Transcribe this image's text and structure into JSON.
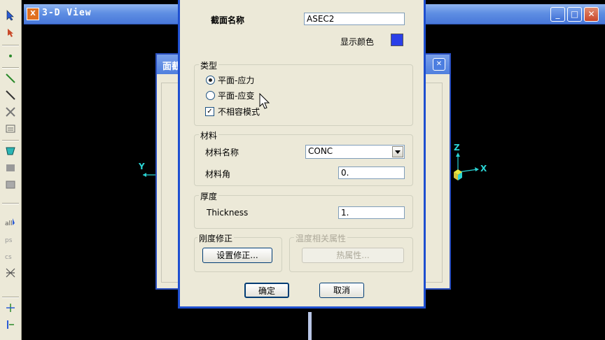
{
  "view_window": {
    "title": "3-D View",
    "minimize": "_",
    "maximize": "□",
    "close": "✕"
  },
  "background_dialog": {
    "title": "面截",
    "close": "✕"
  },
  "axes": {
    "left_y": "Y",
    "right_z": "Z",
    "right_x": "X"
  },
  "dialog": {
    "section_name_label": "截面名称",
    "section_name_value": "ASEC2",
    "display_color_label": "显示颜色",
    "display_color": "#2a3fe8",
    "type_group": {
      "title": "类型",
      "options": [
        {
          "label": "平面-应力",
          "checked": true
        },
        {
          "label": "平面-应变",
          "checked": false
        }
      ],
      "incompatible_mode_label": "不相容模式",
      "incompatible_mode_checked": "✓"
    },
    "material_group": {
      "title": "材料",
      "material_name_label": "材料名称",
      "material_name_value": "CONC",
      "material_angle_label": "材料角",
      "material_angle_value": "0."
    },
    "thickness_group": {
      "title": "厚度",
      "thickness_label": "Thickness",
      "thickness_value": "1."
    },
    "stiffness_group": {
      "title": "刚度修正",
      "button_label": "设置修正..."
    },
    "temperature_group": {
      "title": "温度相关属性",
      "button_label": "热属性..."
    },
    "ok_label": "确定",
    "cancel_label": "取消"
  }
}
